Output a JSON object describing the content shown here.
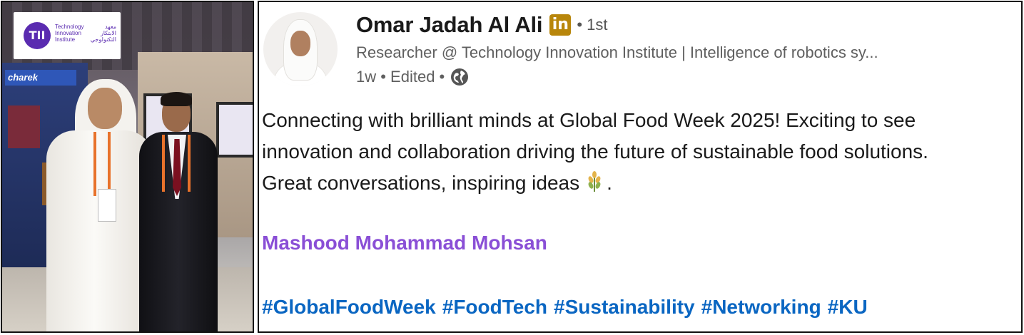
{
  "photo": {
    "logo_mark": "TII",
    "logo_text_en": [
      "Technology",
      "Innovation",
      "Institute"
    ],
    "logo_text_ar": [
      "معهد",
      "الابتكار",
      "التكنولوجي"
    ],
    "booth_sign": "charek"
  },
  "post": {
    "author_name": "Omar Jadah Al Ali",
    "badge_icon": "linkedin-icon",
    "badge_text": "in",
    "connection_degree": "• 1st",
    "headline": "Researcher @ Technology Innovation Institute | Intelligence of robotics sy...",
    "meta_time": "1w • Edited •",
    "visibility_icon": "globe-icon",
    "body_lines": [
      "Connecting with brilliant minds at Global Food Week 2025! Exciting to see",
      "innovation and collaboration driving the future of sustainable food solutions.",
      "Great conversations, inspiring ideas"
    ],
    "body_end": ".",
    "emoji_icon": "wheat-icon",
    "mention": "Mashood Mohammad Mohsan",
    "hashtags": [
      "#GlobalFoodWeek",
      "#FoodTech",
      "#Sustainability",
      "#Networking",
      "#KU"
    ]
  },
  "colors": {
    "mention": "#8a4fd6",
    "hashtag": "#0a66c2",
    "linkedin_badge": "#b8860b",
    "tii_purple": "#5a2bb0"
  }
}
